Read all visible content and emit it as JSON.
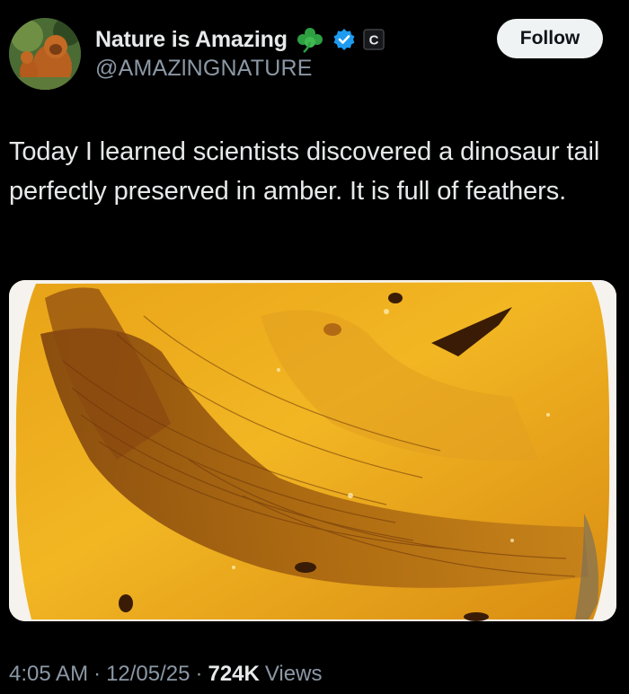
{
  "author": {
    "display_name": "Nature is Amazing",
    "handle": "@AMAZlNGNATURE",
    "emoji_icon": "shamrock-icon",
    "badges": [
      "verified-badge-icon",
      "c-badge-icon"
    ],
    "verified_color": "#1d9bf0"
  },
  "follow_button": {
    "label": "Follow"
  },
  "tweet": {
    "text": "Today I learned scientists discovered a dinosaur tail perfectly preserved in amber. It is full of feathers."
  },
  "media": {
    "description_icon": "amber-fossil-photo",
    "alt": "Dinosaur tail with feathers preserved in amber"
  },
  "meta": {
    "time": "4:05 AM",
    "separator": "·",
    "date": "12/05/25",
    "views_count": "724K",
    "views_label": "Views"
  }
}
